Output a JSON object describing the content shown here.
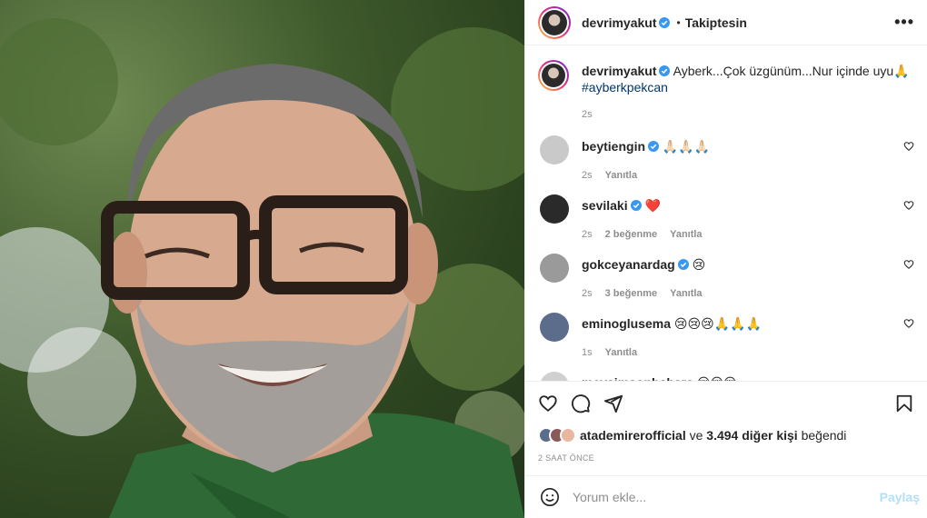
{
  "post": {
    "image_description": "",
    "author": "devrimyakut",
    "follow_status": "Takiptesin",
    "more_icon": "more-horizontal-icon"
  },
  "caption": {
    "username": "devrimyakut",
    "text": "Ayberk...Çok üzgünüm...Nur içinde uyu🙏",
    "hashtag": "#ayberkpekcan",
    "time": "2s"
  },
  "comments": [
    {
      "username": "beytiengin",
      "verified": true,
      "text": "🙏🏻🙏🏻🙏🏻",
      "time": "2s",
      "likes": "",
      "reply": "Yanıtla",
      "avatar_color": "#c9c9c9"
    },
    {
      "username": "sevilaki",
      "verified": true,
      "text": "❤️",
      "time": "2s",
      "likes": "2 beğenme",
      "reply": "Yanıtla",
      "avatar_color": "#2a2a2a"
    },
    {
      "username": "gokceyanardag",
      "verified": true,
      "text": "😢",
      "time": "2s",
      "likes": "3 beğenme",
      "reply": "Yanıtla",
      "avatar_color": "#9a9a9a"
    },
    {
      "username": "eminoglusema",
      "verified": false,
      "text": "😢😢😢🙏🙏🙏",
      "time": "1s",
      "likes": "",
      "reply": "Yanıtla",
      "avatar_color": "#5b6d8a"
    },
    {
      "username": "mevsimsonbahars",
      "verified": false,
      "text": "😢😢😢",
      "time": "",
      "likes": "",
      "reply": "",
      "avatar_color": "#d0d0d0"
    }
  ],
  "likes": {
    "first_liker": "atademirerofficial",
    "connector": "ve",
    "others": "3.494 diğer kişi",
    "suffix": "beğendi"
  },
  "posted_ago": "2 SAAT ÖNCE",
  "add_comment": {
    "placeholder": "Yorum ekle...",
    "submit_label": "Paylaş"
  },
  "colors": {
    "verified": "#3897f0",
    "link": "#00376b",
    "muted": "#8e8e8e",
    "share_disabled": "#b2dffc"
  }
}
